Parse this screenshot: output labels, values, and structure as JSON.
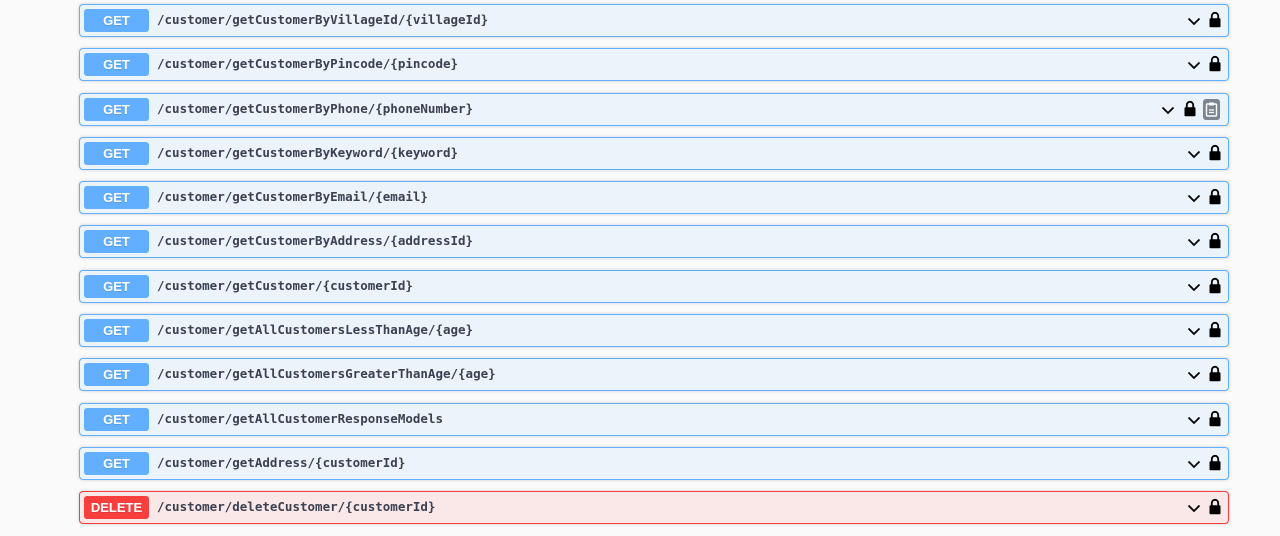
{
  "operations": [
    {
      "method": "GET",
      "path": "/customer/getCustomerByVillageId/{villageId}"
    },
    {
      "method": "GET",
      "path": "/customer/getCustomerByPincode/{pincode}"
    },
    {
      "method": "GET",
      "path": "/customer/getCustomerByPhone/{phoneNumber}"
    },
    {
      "method": "GET",
      "path": "/customer/getCustomerByKeyword/{keyword}"
    },
    {
      "method": "GET",
      "path": "/customer/getCustomerByEmail/{email}"
    },
    {
      "method": "GET",
      "path": "/customer/getCustomerByAddress/{addressId}"
    },
    {
      "method": "GET",
      "path": "/customer/getCustomer/{customerId}"
    },
    {
      "method": "GET",
      "path": "/customer/getAllCustomersLessThanAge/{age}"
    },
    {
      "method": "GET",
      "path": "/customer/getAllCustomersGreaterThanAge/{age}"
    },
    {
      "method": "GET",
      "path": "/customer/getAllCustomerResponseModels"
    },
    {
      "method": "GET",
      "path": "/customer/getAddress/{customerId}"
    },
    {
      "method": "DELETE",
      "path": "/customer/deleteCustomer/{customerId}"
    }
  ],
  "icons": {
    "expand": "chevron-down-icon",
    "auth": "lock-icon",
    "copy": "copy-to-clipboard-icon"
  },
  "colors": {
    "get_accent": "#61affe",
    "get_background": "#ebf3fb",
    "delete_accent": "#f93e3e",
    "delete_background": "#fae7e7",
    "path_text": "#3b4151"
  }
}
